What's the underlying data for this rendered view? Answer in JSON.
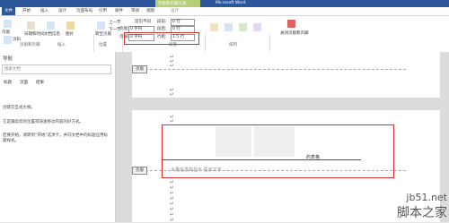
{
  "window": {
    "title": "Microsoft Word",
    "context_group": "页眉和页脚工具"
  },
  "tabs": [
    {
      "label": "文件"
    },
    {
      "label": "开始"
    },
    {
      "label": "插入"
    },
    {
      "label": "设计"
    },
    {
      "label": "页面布局"
    },
    {
      "label": "引用"
    },
    {
      "label": "邮件"
    },
    {
      "label": "审阅"
    },
    {
      "label": "视图"
    },
    {
      "label": "设计"
    }
  ],
  "ribbon": {
    "buttons": [
      "页眉",
      "页脚",
      "页码",
      "日期和时间",
      "文档信息",
      "文档部件",
      "图片",
      "联机图片",
      "转至页眉",
      "转至页脚",
      "上一节",
      "下一节",
      "链接到前一条页眉",
      "首页不同",
      "奇偶页不同",
      "显示文档文字",
      "关闭页眉和页脚"
    ],
    "fields": [
      {
        "label": "页眉顶端距离:",
        "value": "0 字符"
      },
      {
        "label": "页脚底端距离:",
        "value": "0 字符"
      },
      {
        "label": "段前:",
        "value": "0 行"
      },
      {
        "label": "段后:",
        "value": "0 行"
      },
      {
        "label": "行距:",
        "value": "1.5 行"
      }
    ],
    "groups": [
      "页眉和页脚",
      "插入",
      "导航",
      "选项",
      "位置",
      "段落",
      "排列"
    ]
  },
  "nav": {
    "title": "导航",
    "search_placeholder": "搜索文档",
    "tabs": [
      "标题",
      "页面",
      "结果"
    ],
    "lines": [
      "创建交互式大纲。",
      "它是跟踪您的位置或快速移动内容的好方式。",
      "若要开始，请转到“开始”选项卡，并向文档中的标题应用标题样式。"
    ]
  },
  "doc": {
    "header_tag": "页眉",
    "footer_tag": "页眉",
    "cell_text": "的表格",
    "footer_line": "大量信息的显示  提示文字"
  },
  "watermark": {
    "line1": "jb51.net",
    "line2": "脚本之家"
  },
  "colors": {
    "word_blue": "#2b579a",
    "context_green": "#b4cf77",
    "highlight_red": "#d32f2f"
  }
}
